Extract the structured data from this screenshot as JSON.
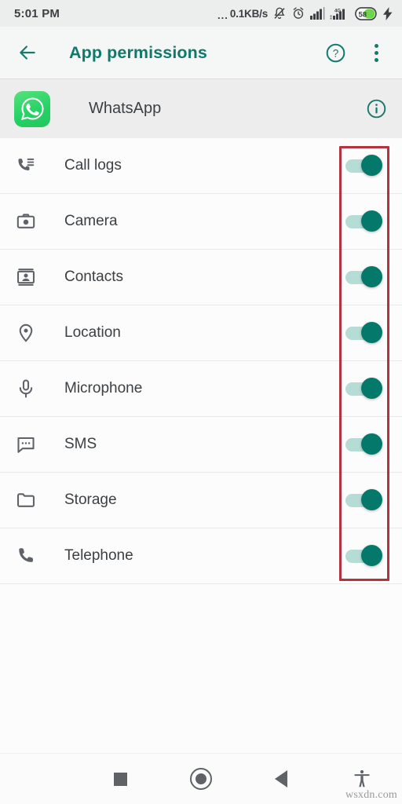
{
  "status_bar": {
    "time": "5:01 PM",
    "net_speed": "0.1KB/s",
    "net_speed_prefix": "...",
    "icons": [
      "bell-muted-icon",
      "alarm-clock-icon",
      "signal-bars-icon",
      "signal-4g-icon",
      "battery-icon",
      "charging-bolt-icon"
    ],
    "battery_percent": "58",
    "network_type": "4G",
    "battery_color": "#6dd44c"
  },
  "app_bar": {
    "back_label": "back-arrow",
    "title": "App permissions",
    "help_label": "?",
    "overflow_label": "more-options",
    "accent_color": "#0f7a6c"
  },
  "app_header": {
    "app_name": "WhatsApp",
    "app_icon": "whatsapp-icon",
    "app_icon_color": "#25d366",
    "info_label": "i"
  },
  "permissions": {
    "toggle_on_color": "#04796b",
    "toggle_track_color": "#b6dcd6",
    "items": [
      {
        "label": "Call logs",
        "icon": "call-logs-icon",
        "state": "on"
      },
      {
        "label": "Camera",
        "icon": "camera-icon",
        "state": "on"
      },
      {
        "label": "Contacts",
        "icon": "contacts-icon",
        "state": "on"
      },
      {
        "label": "Location",
        "icon": "location-pin-icon",
        "state": "on"
      },
      {
        "label": "Microphone",
        "icon": "microphone-icon",
        "state": "on"
      },
      {
        "label": "SMS",
        "icon": "sms-icon",
        "state": "on"
      },
      {
        "label": "Storage",
        "icon": "folder-icon",
        "state": "on"
      },
      {
        "label": "Telephone",
        "icon": "phone-icon",
        "state": "on"
      }
    ]
  },
  "annotation": {
    "shape": "rectangle",
    "color": "#b5333f",
    "target": "permission-toggles-column"
  },
  "nav_bar": {
    "buttons": [
      {
        "name": "recents",
        "icon": "square-icon"
      },
      {
        "name": "home",
        "icon": "circle-icon"
      },
      {
        "name": "back",
        "icon": "triangle-icon"
      },
      {
        "name": "accessibility",
        "icon": "accessibility-icon"
      }
    ]
  },
  "watermark": {
    "text": "wsxdn.com"
  }
}
